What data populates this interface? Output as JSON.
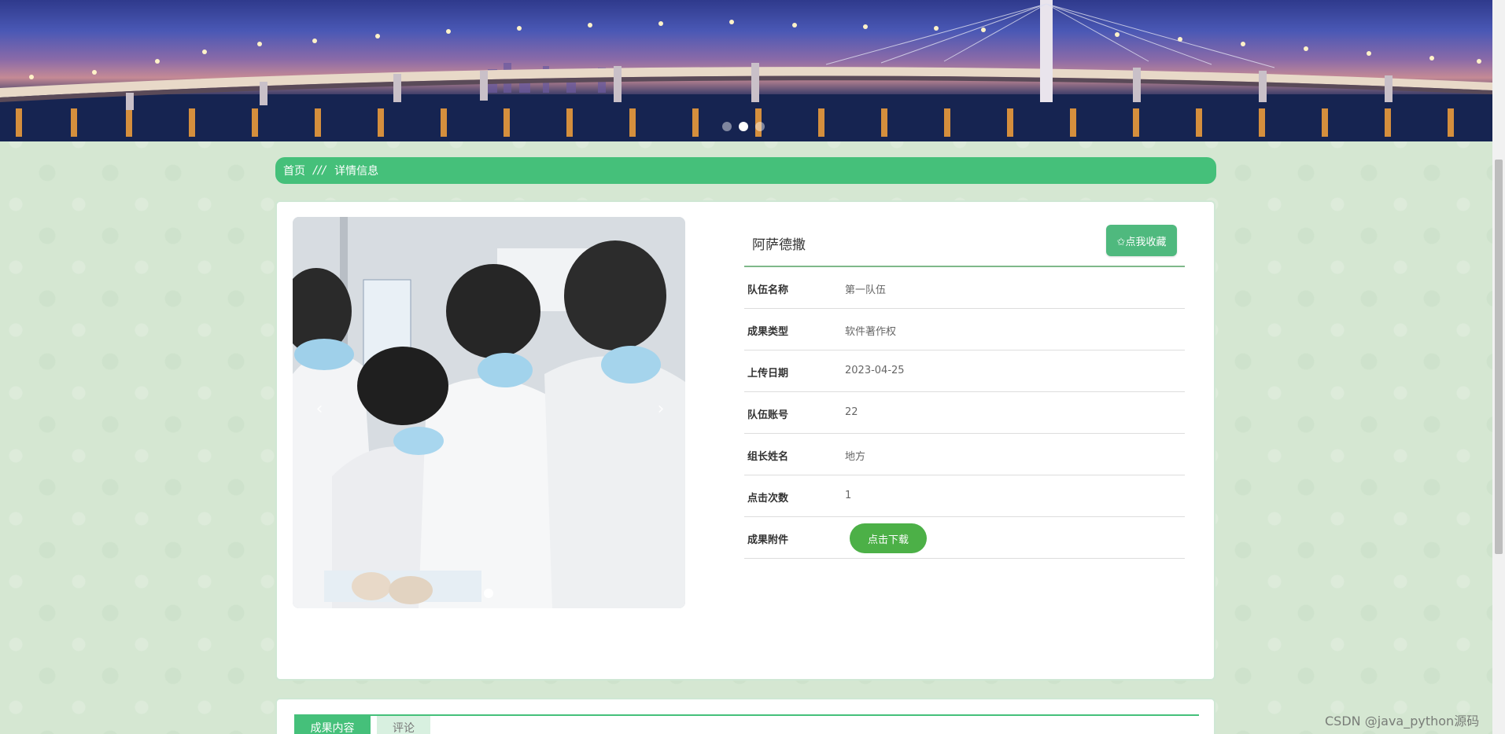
{
  "banner": {
    "dots": [
      {
        "label": "",
        "active": false
      },
      {
        "label": "",
        "active": true
      },
      {
        "label": "",
        "active": false
      }
    ]
  },
  "breadcrumb": {
    "home": "首页",
    "separator": "///",
    "current": "详情信息"
  },
  "detail": {
    "title": "阿萨德撒",
    "favorite_button": "✩点我收藏",
    "fields": [
      {
        "label": "队伍名称",
        "value": "第一队伍"
      },
      {
        "label": "成果类型",
        "value": "软件著作权"
      },
      {
        "label": "上传日期",
        "value": "2023-04-25"
      },
      {
        "label": "队伍账号",
        "value": "22"
      },
      {
        "label": "组长姓名",
        "value": "地方"
      },
      {
        "label": "点击次数",
        "value": "1"
      }
    ],
    "attachment": {
      "label": "成果附件",
      "button": "点击下载"
    },
    "carousel": {
      "prev_icon": "‹",
      "next_icon": "›"
    }
  },
  "tabs": [
    {
      "label": "成果内容",
      "active": true
    },
    {
      "label": "评论",
      "active": false
    }
  ],
  "watermark": "CSDN @java_python源码",
  "colors": {
    "accent": "#45c07a",
    "download": "#4cb047",
    "favorite": "#4fb97e",
    "background": "#d5e7d2"
  }
}
